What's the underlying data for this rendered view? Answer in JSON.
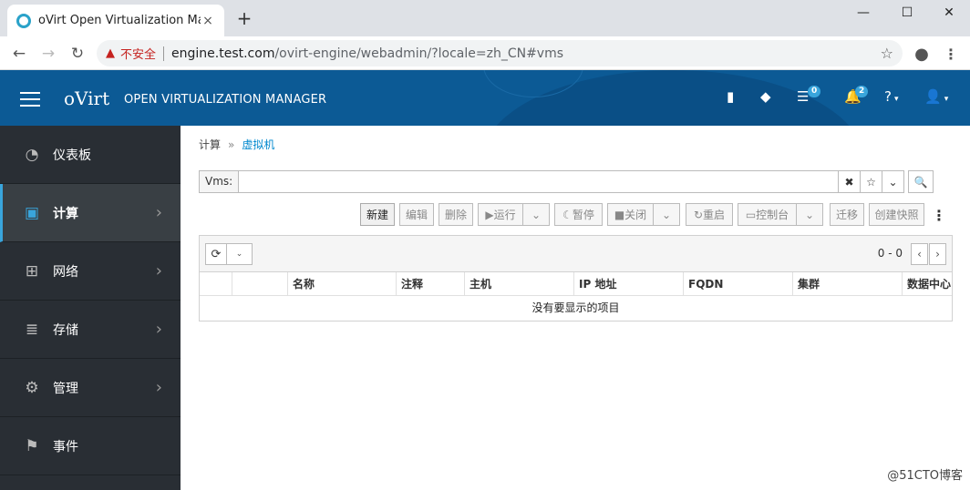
{
  "browser": {
    "tab_title": "oVirt Open Virtualization Manager",
    "tab_close": "×",
    "new_tab": "+",
    "minimize": "—",
    "maximize": "☐",
    "close": "✕",
    "security_label": "不安全",
    "url_host": "engine.test.com",
    "url_path": "/ovirt-engine/webadmin/?locale=zh_CN#vms"
  },
  "header": {
    "brand": "oVirt",
    "product": "OPEN VIRTUALIZATION MANAGER",
    "tasks_badge": "0",
    "events_badge": "2"
  },
  "sidebar": {
    "items": [
      {
        "label": "仪表板",
        "icon": "dashboard-icon"
      },
      {
        "label": "计算",
        "icon": "chip-icon"
      },
      {
        "label": "网络",
        "icon": "network-icon"
      },
      {
        "label": "存储",
        "icon": "database-icon"
      },
      {
        "label": "管理",
        "icon": "gear-icon"
      },
      {
        "label": "事件",
        "icon": "flag-icon"
      }
    ]
  },
  "breadcrumb": {
    "parent": "计算",
    "current": "虚拟机"
  },
  "search": {
    "prefix": "Vms:",
    "value": ""
  },
  "toolbar": {
    "new": "新建",
    "edit": "编辑",
    "remove": "删除",
    "run": "运行",
    "suspend": "暂停",
    "shutdown": "关闭",
    "reboot": "重启",
    "console": "控制台",
    "migrate": "迁移",
    "snapshot": "创建快照"
  },
  "table": {
    "pager": "0 - 0",
    "columns": [
      "名称",
      "注释",
      "主机",
      "IP 地址",
      "FQDN",
      "集群",
      "数据中心"
    ],
    "empty_message": "没有要显示的项目"
  },
  "watermark": "@51CTO博客",
  "colors": {
    "header_bg": "#0c5a95",
    "sidebar_bg": "#292e34",
    "accent": "#39a5dc",
    "insecure": "#c5221f"
  }
}
